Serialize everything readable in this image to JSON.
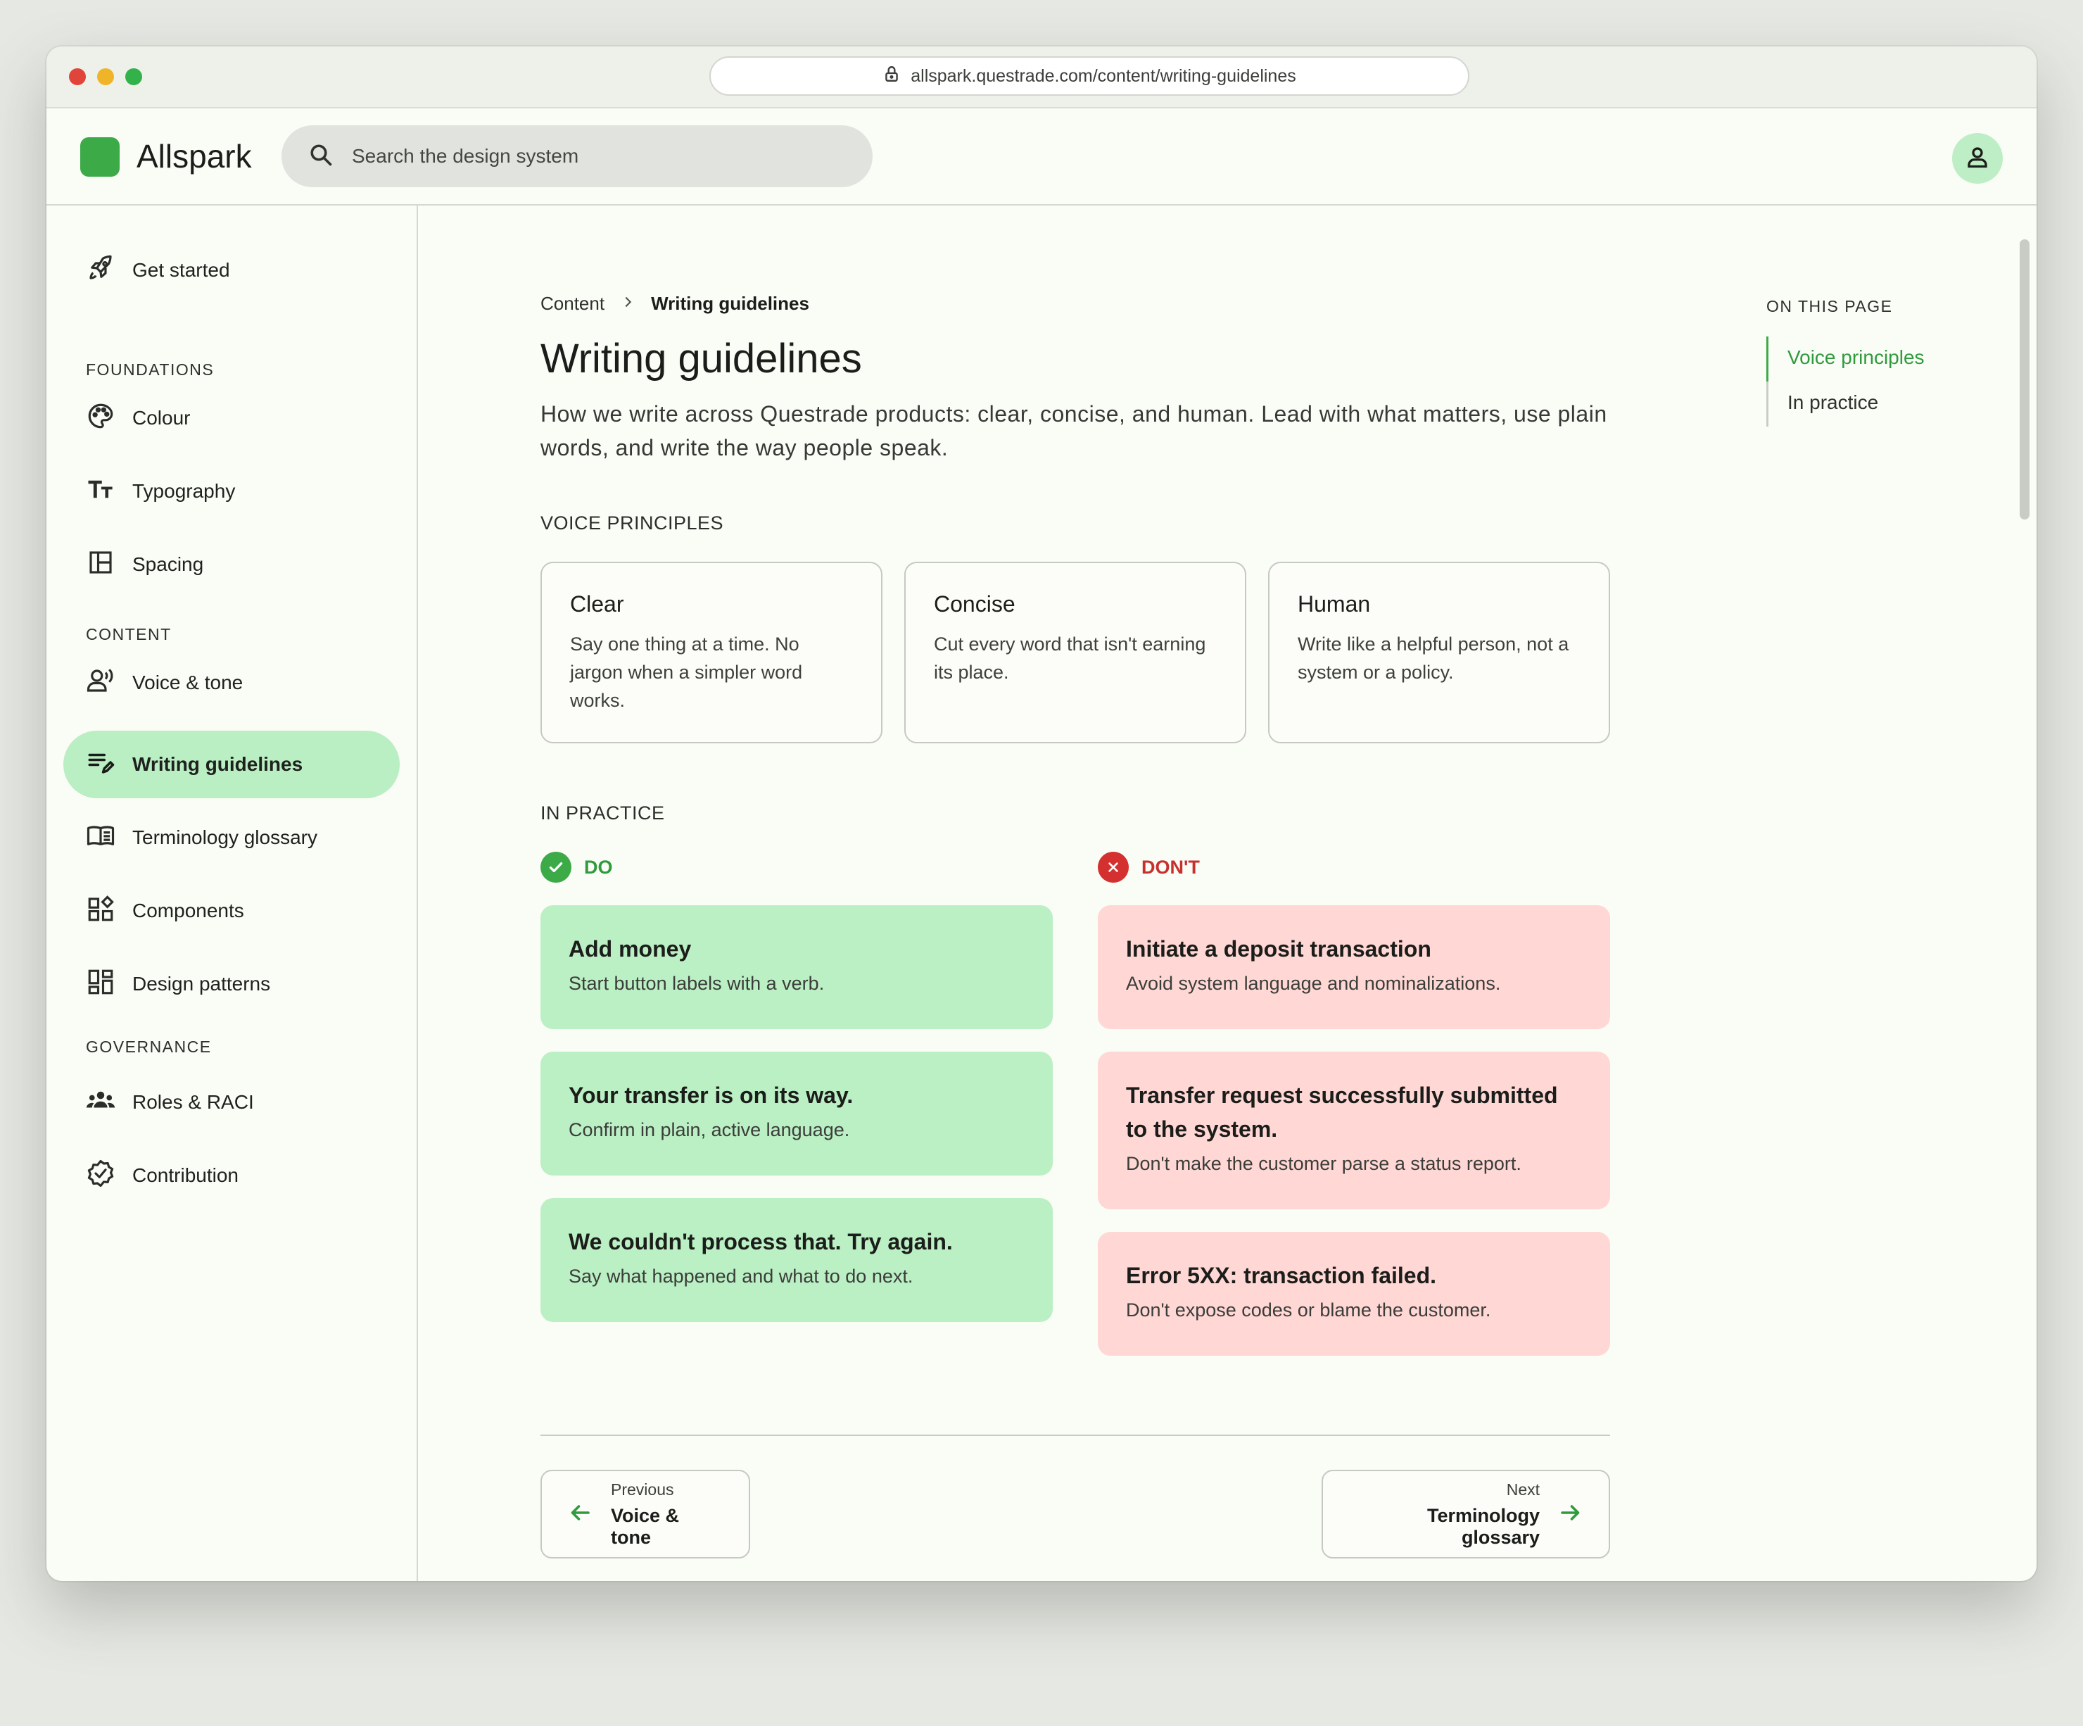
{
  "browser": {
    "url": "allspark.questrade.com/content/writing-guidelines"
  },
  "header": {
    "brand": "Allspark",
    "search_placeholder": "Search the design system"
  },
  "sidebar": {
    "get_started": "Get started",
    "sections": {
      "foundations": "FOUNDATIONS",
      "content": "CONTENT",
      "governance": "GOVERNANCE"
    },
    "items": {
      "colour": "Colour",
      "typography": "Typography",
      "spacing": "Spacing",
      "voice_tone": "Voice & tone",
      "writing_guidelines": "Writing guidelines",
      "terminology": "Terminology glossary",
      "components": "Components",
      "design_patterns": "Design patterns",
      "roles": "Roles & RACI",
      "contribution": "Contribution"
    },
    "active": "writing_guidelines"
  },
  "main": {
    "breadcrumb": {
      "parent": "Content",
      "current": "Writing guidelines"
    },
    "title": "Writing guidelines",
    "lead": "How we write across Questrade products: clear, concise, and human. Lead with what matters, use plain words, and write the way people speak.",
    "voice_label": "VOICE PRINCIPLES",
    "principles": [
      {
        "title": "Clear",
        "body": "Say one thing at a time. No jargon when a simpler word works."
      },
      {
        "title": "Concise",
        "body": "Cut every word that isn't earning its place."
      },
      {
        "title": "Human",
        "body": "Write like a helpful person, not a system or a policy."
      }
    ],
    "practice_label": "IN PRACTICE",
    "do_label": "DO",
    "dont_label": "DON'T",
    "do": [
      {
        "title": "Add money",
        "body": "Start button labels with a verb."
      },
      {
        "title": "Your transfer is on its way.",
        "body": "Confirm in plain, active language."
      },
      {
        "title": "We couldn't process that. Try again.",
        "body": "Say what happened and what to do next."
      }
    ],
    "dont": [
      {
        "title": "Initiate a deposit transaction",
        "body": "Avoid system language and nominalizations."
      },
      {
        "title": "Transfer request successfully submitted to the system.",
        "body": "Don't make the customer parse a status report."
      },
      {
        "title": "Error 5XX: transaction failed.",
        "body": "Don't expose codes or blame the customer."
      }
    ],
    "pager": {
      "prev_meta": "Previous",
      "prev_dest": "Voice & tone",
      "next_meta": "Next",
      "next_dest": "Terminology glossary"
    }
  },
  "toc": {
    "label": "ON THIS PAGE",
    "items": [
      "Voice principles",
      "In practice"
    ],
    "active_index": 0
  },
  "colors": {
    "accent": "#3daa48",
    "active_nav": "#baeec3",
    "do_bg": "#bbefc4",
    "dont_bg": "#ffd7d5",
    "dont_accent": "#d3302f"
  }
}
